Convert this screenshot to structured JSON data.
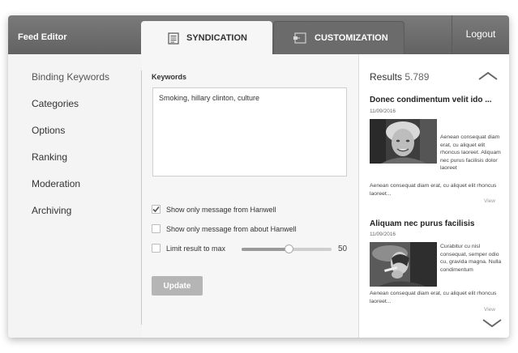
{
  "app": {
    "title": "Feed Editor"
  },
  "tabs": {
    "syndication": {
      "label": "SYNDICATION",
      "icon": "document-icon"
    },
    "customization": {
      "label": "CUSTOMIZATION",
      "icon": "customize-icon"
    }
  },
  "header": {
    "logout_label": "Logout"
  },
  "sidebar": {
    "items": [
      {
        "label": "Binding Keywords"
      },
      {
        "label": "Categories"
      },
      {
        "label": "Options"
      },
      {
        "label": "Ranking"
      },
      {
        "label": "Moderation"
      },
      {
        "label": "Archiving"
      }
    ]
  },
  "editor": {
    "keywords_label": "Keywords",
    "keywords_value": "Smoking, hillary clinton, culture",
    "options": [
      {
        "label": "Show only message from Hanwell",
        "checked": true
      },
      {
        "label": "Show only message from about Hanwell",
        "checked": false
      },
      {
        "label": "Limit result to max",
        "checked": false
      }
    ],
    "slider": {
      "value": "50",
      "fill_fraction": 0.52
    },
    "update_label": "Update"
  },
  "results": {
    "label": "Results",
    "count": "5.789",
    "articles": [
      {
        "title": "Donec condimentum velit  ido ...",
        "date": "11/09/2016",
        "side_text": "Aenean consequat diam erat, cu aliquet elit rhoncus laoreet. Aliquam nec purus facilisis dolor laoreet",
        "body_text": "Aenean consequat diam erat, cu aliquet elit rhoncus laoreet...",
        "view_label": "View"
      },
      {
        "title": "Aliquam nec purus facilisis",
        "date": "11/09/2016",
        "side_text": "Curabitur cu nisl consequat, semper odio cu, gravida magna. Nulla condimentum",
        "body_text": "Aenean consequat diam erat, cu aliquet elit rhoncus laoreet...",
        "view_label": "View"
      }
    ]
  },
  "colors": {
    "topbar": "#6e6e6e",
    "panel": "#f4f4f4",
    "button": "#b5b5b5"
  }
}
